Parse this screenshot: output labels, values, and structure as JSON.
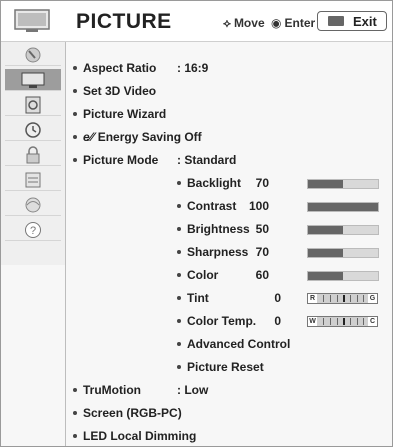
{
  "header": {
    "title": "PICTURE",
    "move_hint": "Move",
    "enter_hint": "Enter",
    "exit_label": "Exit",
    "move_symbol": "⟡",
    "enter_symbol": "◉"
  },
  "sidebar": {
    "items": [
      {
        "icon": "satellite-dish-icon",
        "active": false
      },
      {
        "icon": "picture-tv-icon",
        "active": true
      },
      {
        "icon": "speaker-icon",
        "active": false
      },
      {
        "icon": "clock-icon",
        "active": false
      },
      {
        "icon": "lock-icon",
        "active": false
      },
      {
        "icon": "option-box-icon",
        "active": false
      },
      {
        "icon": "network-icon",
        "active": false
      },
      {
        "icon": "help-question-icon",
        "active": false,
        "glyph": "?"
      }
    ]
  },
  "menu": {
    "aspect_ratio": {
      "label": "Aspect Ratio",
      "value": ": 16:9"
    },
    "set_3d_video": {
      "label": "Set 3D Video"
    },
    "picture_wizard": {
      "label": "Picture Wizard"
    },
    "energy_saving": {
      "label": "Energy Saving",
      "value": ": Off",
      "prefix": "e⁄⁄"
    },
    "picture_mode": {
      "label": "Picture Mode",
      "value": ": Standard"
    },
    "backlight": {
      "label": "Backlight",
      "value": "70",
      "level": 0.5
    },
    "contrast": {
      "label": "Contrast",
      "value": "100",
      "level": 1.0
    },
    "brightness": {
      "label": "Brightness",
      "value": "50",
      "level": 0.5
    },
    "sharpness": {
      "label": "Sharpness",
      "value": "70",
      "level": 0.5
    },
    "color": {
      "label": "Color",
      "value": "60",
      "level": 0.5
    },
    "tint": {
      "label": "Tint",
      "value": "0",
      "left": "R",
      "right": "G"
    },
    "color_temp": {
      "label": "Color Temp.",
      "value": "0",
      "left": "W",
      "right": "C"
    },
    "advanced_control": {
      "label": "Advanced Control"
    },
    "picture_reset": {
      "label": "Picture Reset"
    },
    "trumotion": {
      "label": "TruMotion",
      "value": ": Low"
    },
    "screen_rgb_pc": {
      "label": "Screen (RGB-PC)"
    },
    "led_local_dimming": {
      "label": "LED Local Dimming"
    }
  },
  "colors": {
    "active_sidebar": "#9d9d9d",
    "bar_fill": "#666666",
    "bar_track": "#d9d9d9"
  }
}
